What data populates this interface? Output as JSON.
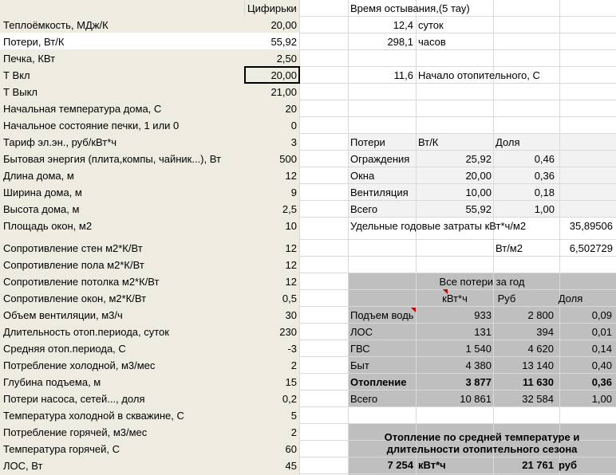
{
  "header": {
    "values_col": "Цифирьки",
    "cooling": "Время остывания,(5 тау)"
  },
  "params": [
    {
      "label": "Теплоёмкость, МДж/К",
      "value": "20,00"
    },
    {
      "label": "Потери, Вт/К",
      "value": "55,92"
    },
    {
      "label": "Печка, КВт",
      "value": "2,50"
    },
    {
      "label": "Т Вкл",
      "value": "20,00"
    },
    {
      "label": "Т Выкл",
      "value": "21,00"
    },
    {
      "label": "Начальная температура дома, С",
      "value": "20"
    },
    {
      "label": "Начальное состояние печки, 1 или 0",
      "value": "0"
    },
    {
      "label": "Тариф эл.эн., руб/кВт*ч",
      "value": "3"
    },
    {
      "label": "Бытовая энергия (плита,компы, чайник...), Вт",
      "value": "500"
    },
    {
      "label": "Длина дома, м",
      "value": "12"
    },
    {
      "label": "Ширина дома, м",
      "value": "9"
    },
    {
      "label": "Высота дома, м",
      "value": "2,5"
    },
    {
      "label": "Площадь окон, м2",
      "value": "10"
    },
    {
      "label": "Сопротивление стен м2*К/Вт",
      "value": "12"
    },
    {
      "label": "Сопротивление пола м2*К/Вт",
      "value": "12"
    },
    {
      "label": "Сопротивление потолка м2*К/Вт",
      "value": "12"
    },
    {
      "label": "Сопротивление окон, м2*К/Вт",
      "value": "0,5"
    },
    {
      "label": "Объем вентиляции, м3/ч",
      "value": "30"
    },
    {
      "label": "Длительность отоп.периода, суток",
      "value": "230"
    },
    {
      "label": "Средняя отоп.периода, С",
      "value": "-3"
    },
    {
      "label": "Потребление холодной, м3/мес",
      "value": "2"
    },
    {
      "label": "Глубина подъема, м",
      "value": "15"
    },
    {
      "label": "Потери насоса, сетей..., доля",
      "value": "0,2"
    },
    {
      "label": "Температура холодной в скважине, С",
      "value": "5"
    },
    {
      "label": "Потребление горячей, м3/мес",
      "value": "2"
    },
    {
      "label": "Температура горячей, С",
      "value": "60"
    },
    {
      "label": "ЛОС, Вт",
      "value": "45"
    }
  ],
  "cooling": [
    {
      "value": "12,4",
      "unit": "суток"
    },
    {
      "value": "298,1",
      "unit": "часов"
    }
  ],
  "heating_start": {
    "value": "11,6",
    "label": "Начало отопительного, С"
  },
  "losses": {
    "headers": [
      "Потери",
      "Вт/К",
      "Доля"
    ],
    "rows": [
      {
        "name": "Ограждения",
        "wk": "25,92",
        "share": "0,46"
      },
      {
        "name": "Окна",
        "wk": "20,00",
        "share": "0,36"
      },
      {
        "name": "Вентиляция",
        "wk": "10,00",
        "share": "0,18"
      },
      {
        "name": "Всего",
        "wk": "55,92",
        "share": "1,00"
      }
    ]
  },
  "specific": {
    "label": "Удельные годовые затраты кВт*ч/м2",
    "value1": "35,89506",
    "unit2": "Вт/м2",
    "value2": "6,502729"
  },
  "annual": {
    "title": "Все потери за год",
    "headers": [
      "кВт*ч",
      "Руб",
      "Доля"
    ],
    "rows": [
      {
        "name": "Подъем воды",
        "kwh": "933",
        "rub": "2 800",
        "share": "0,09"
      },
      {
        "name": "ЛОС",
        "kwh": "131",
        "rub": "394",
        "share": "0,01"
      },
      {
        "name": "ГВС",
        "kwh": "1 540",
        "rub": "4 620",
        "share": "0,14"
      },
      {
        "name": "Быт",
        "kwh": "4 380",
        "rub": "13 140",
        "share": "0,40"
      },
      {
        "name": "Отопление",
        "kwh": "3 877",
        "rub": "11 630",
        "share": "0,36"
      },
      {
        "name": "Всего",
        "kwh": "10 861",
        "rub": "32 584",
        "share": "1,00"
      }
    ]
  },
  "summary": {
    "title1": "Отопление по средней температуре и",
    "title2": "длительности отопительного сезона",
    "kwh": "7 254",
    "kwh_unit": "кВт*ч",
    "rub": "21 761",
    "rub_unit": "руб"
  },
  "colors": {
    "beige": "#eeece1",
    "light_gray": "#f2f2f2",
    "dark_gray": "#bfbfbf"
  }
}
